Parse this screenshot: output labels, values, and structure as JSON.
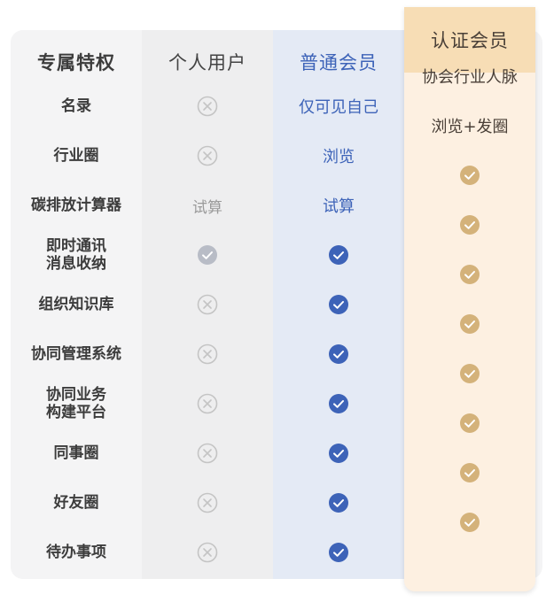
{
  "header": {
    "features": "专属特权",
    "personal": "个人用户",
    "normal": "普通会员",
    "certified": "认证会员"
  },
  "colors": {
    "normal_accent": "#3d63b8",
    "cert_accent": "#d4b27a",
    "disabled_check": "#b8bcc6",
    "cross": "#c4c4c4"
  },
  "rows": [
    {
      "feature": "名录",
      "personal": {
        "type": "cross"
      },
      "normal": {
        "type": "text",
        "text": "仅可见自己"
      },
      "cert": {
        "type": "text",
        "text": "协会行业人脉"
      }
    },
    {
      "feature": "行业圈",
      "personal": {
        "type": "cross"
      },
      "normal": {
        "type": "text",
        "text": "浏览"
      },
      "cert": {
        "type": "text",
        "text": "浏览+发圈"
      }
    },
    {
      "feature": "碳排放计算器",
      "personal": {
        "type": "text",
        "text": "试算"
      },
      "normal": {
        "type": "text",
        "text": "试算"
      },
      "cert": {
        "type": "check"
      }
    },
    {
      "feature": "即时通讯\n消息收纳",
      "personal": {
        "type": "check-gray"
      },
      "normal": {
        "type": "check"
      },
      "cert": {
        "type": "check"
      }
    },
    {
      "feature": "组织知识库",
      "personal": {
        "type": "cross"
      },
      "normal": {
        "type": "check"
      },
      "cert": {
        "type": "check"
      }
    },
    {
      "feature": "协同管理系统",
      "personal": {
        "type": "cross"
      },
      "normal": {
        "type": "check"
      },
      "cert": {
        "type": "check"
      }
    },
    {
      "feature": "协同业务\n构建平台",
      "personal": {
        "type": "cross"
      },
      "normal": {
        "type": "check"
      },
      "cert": {
        "type": "check"
      }
    },
    {
      "feature": "同事圈",
      "personal": {
        "type": "cross"
      },
      "normal": {
        "type": "check"
      },
      "cert": {
        "type": "check"
      }
    },
    {
      "feature": "好友圈",
      "personal": {
        "type": "cross"
      },
      "normal": {
        "type": "check"
      },
      "cert": {
        "type": "check"
      }
    },
    {
      "feature": "待办事项",
      "personal": {
        "type": "cross"
      },
      "normal": {
        "type": "check"
      },
      "cert": {
        "type": "check"
      }
    }
  ]
}
